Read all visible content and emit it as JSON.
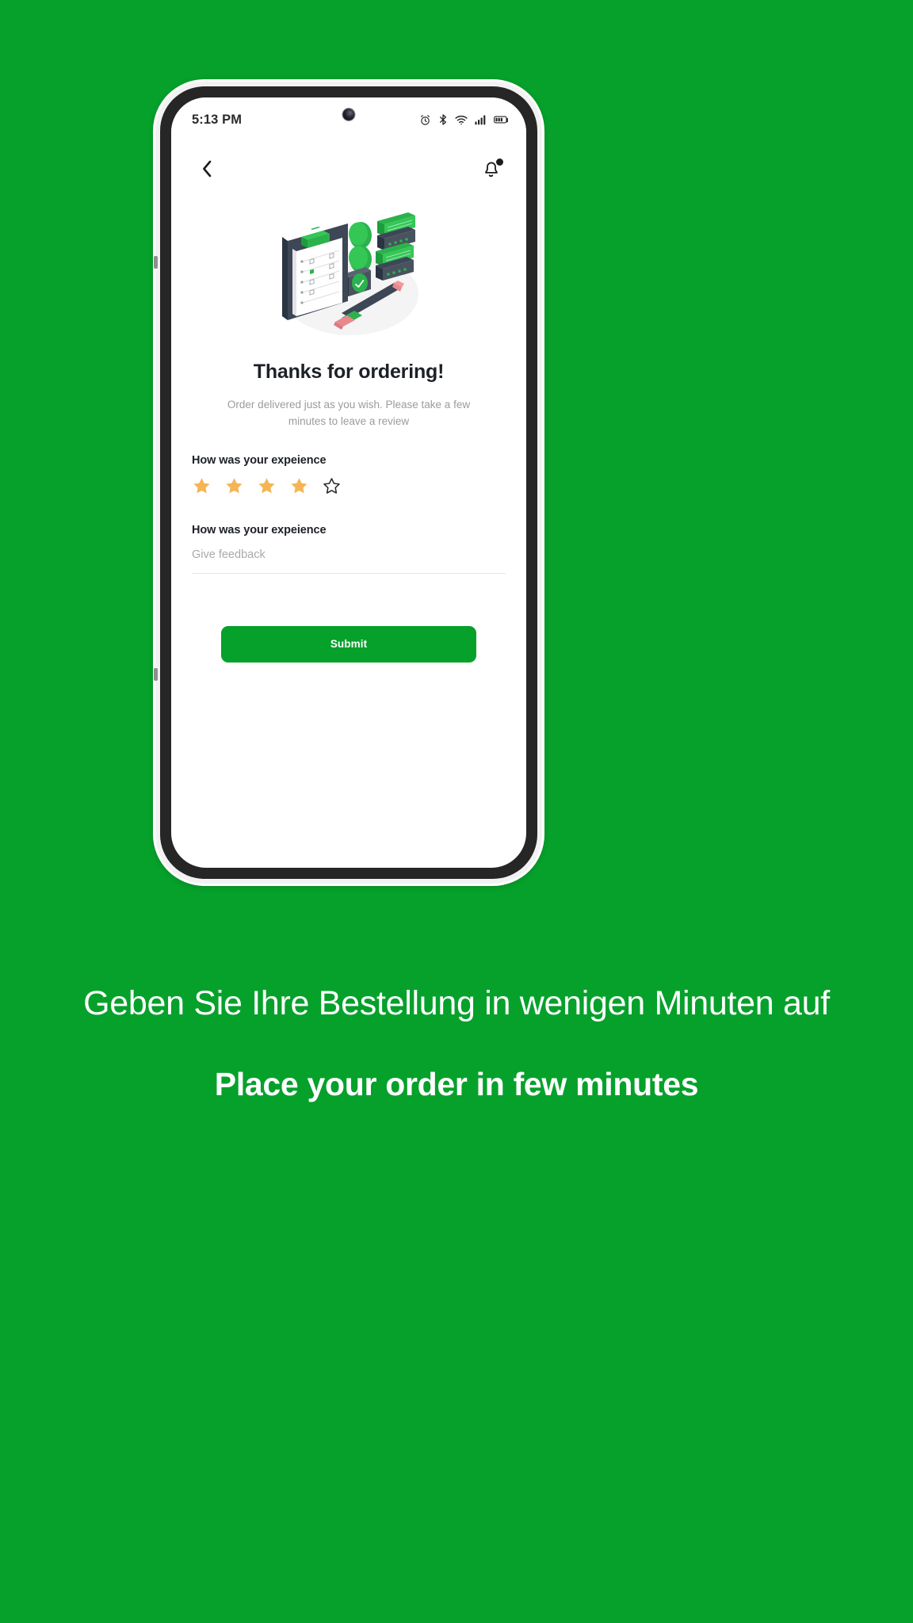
{
  "theme": {
    "brand_green": "#06a12b",
    "star_filled": "#f5b556",
    "star_empty_outline": "#2b2b2b",
    "text_dark": "#1d2026",
    "text_muted": "#9b9ba1",
    "phone_body": "#262626",
    "screen_bg": "#ffffff"
  },
  "phone": {
    "status_bar": {
      "time": "5:13 PM",
      "camera": "front-camera-punch-hole",
      "icons": [
        {
          "name": "alarm-icon",
          "label": "Alarm"
        },
        {
          "name": "bluetooth-icon",
          "label": "Bluetooth"
        },
        {
          "name": "wifi-icon",
          "label": "Wi-Fi"
        },
        {
          "name": "cellular-signal-icon",
          "label": "Signal"
        },
        {
          "name": "battery-icon",
          "label": "Battery"
        }
      ]
    },
    "app_bar": {
      "back_icon": "chevron-left-icon",
      "notification_icon": "bell-icon",
      "notification_badge": true
    },
    "illustration": {
      "name": "review-clipboard-illustration",
      "alt": "Isometric clipboard with checklist, chat bars and pencil"
    },
    "screen": {
      "headline": "Thanks for ordering!",
      "subtitle": "Order delivered just as you wish. Please take a few minutes to leave a review",
      "rating_label": "How was your expeience",
      "rating": {
        "value": 4,
        "max": 5,
        "stars": [
          "filled",
          "filled",
          "filled",
          "filled",
          "empty"
        ]
      },
      "feedback_label": "How was your expeience",
      "feedback_value": "",
      "feedback_placeholder": "Give feedback",
      "submit_label": "Submit"
    }
  },
  "captions": {
    "german": "Geben Sie Ihre Bestellung in wenigen Minuten auf",
    "english": "Place your order in few minutes"
  }
}
